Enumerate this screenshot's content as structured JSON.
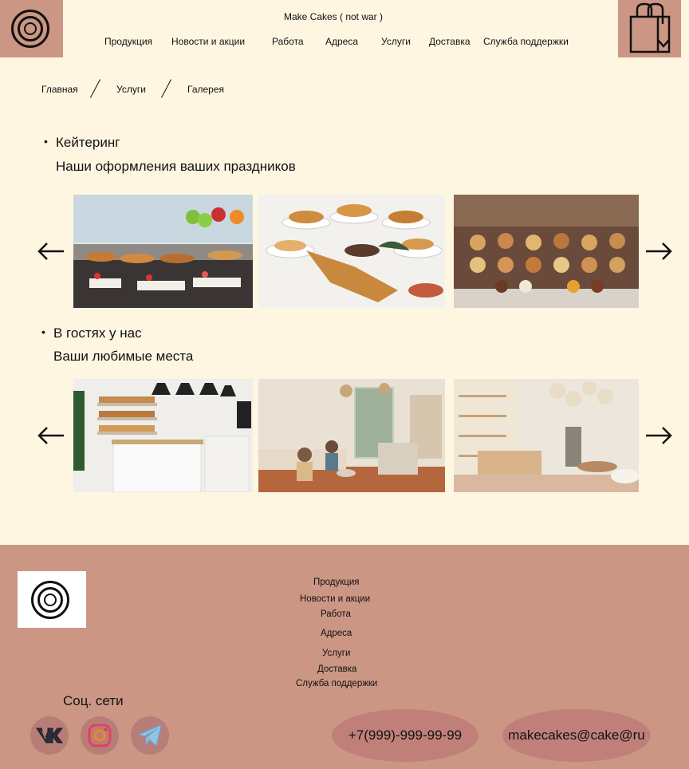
{
  "header": {
    "brand": "Make Cakes ( not war )",
    "nav": [
      "Продукция",
      "Новости и акции",
      "Работа",
      "Адреса",
      "Услуги",
      "Доставка",
      "Служба поддержки"
    ],
    "logo_icon": "donut-logo-icon",
    "cart_icon": "shopping-bag-icon"
  },
  "breadcrumb": [
    "Главная",
    "Услуги",
    "Галерея"
  ],
  "sections": [
    {
      "title": "Кейтеринг",
      "subtitle": "Наши оформления ваших праздников",
      "photos": [
        "catering-buffet-photo",
        "pastry-display-photo",
        "bakery-table-photo"
      ]
    },
    {
      "title": "В гостях у нас",
      "subtitle": "Ваши любимые места",
      "photos": [
        "bakery-interior-photo",
        "cafe-seating-photo",
        "cafe-hall-photo"
      ]
    }
  ],
  "footer": {
    "links": [
      "Продукция",
      "Новости и акции",
      "Работа",
      "Адреса",
      "Услуги",
      "Доставка",
      "Служба поддержки"
    ],
    "social_title": "Соц. сети",
    "phone": "+7(999)-999-99-99",
    "email": "makecakes@cake@ru"
  },
  "colors": {
    "background": "#fff6e2",
    "accent": "#cc9684",
    "pill": "#c08079",
    "social_circle": "#b77e78"
  }
}
